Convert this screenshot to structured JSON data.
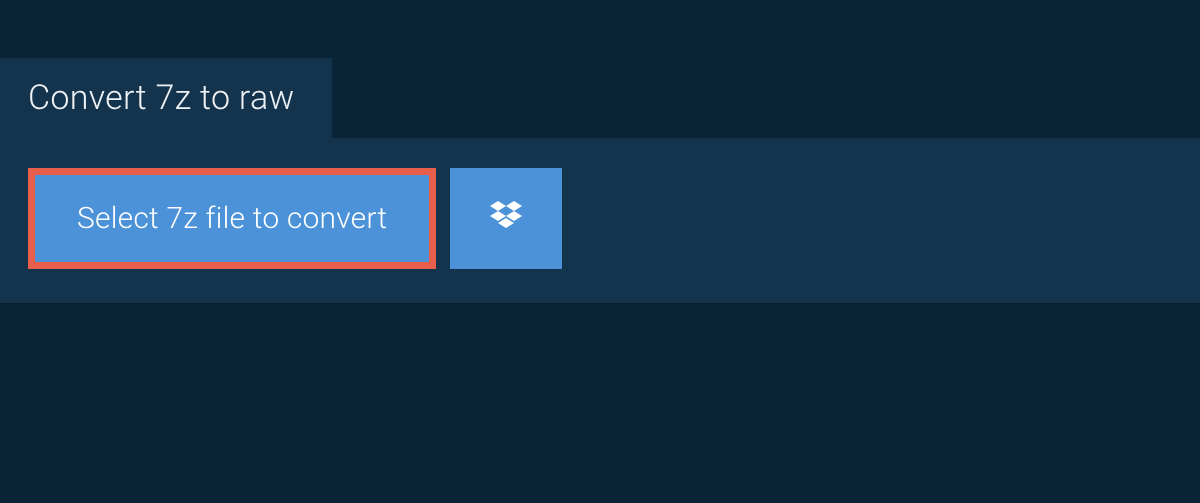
{
  "tab": {
    "title": "Convert 7z to raw"
  },
  "actions": {
    "select_file_label": "Select 7z file to convert",
    "dropbox_icon": "dropbox-icon"
  },
  "colors": {
    "page_bg": "#0a2438",
    "panel_bg": "#14344e",
    "button_bg": "#4b92d8",
    "highlight_border": "#e8604c",
    "text_light": "#eef2f5"
  }
}
